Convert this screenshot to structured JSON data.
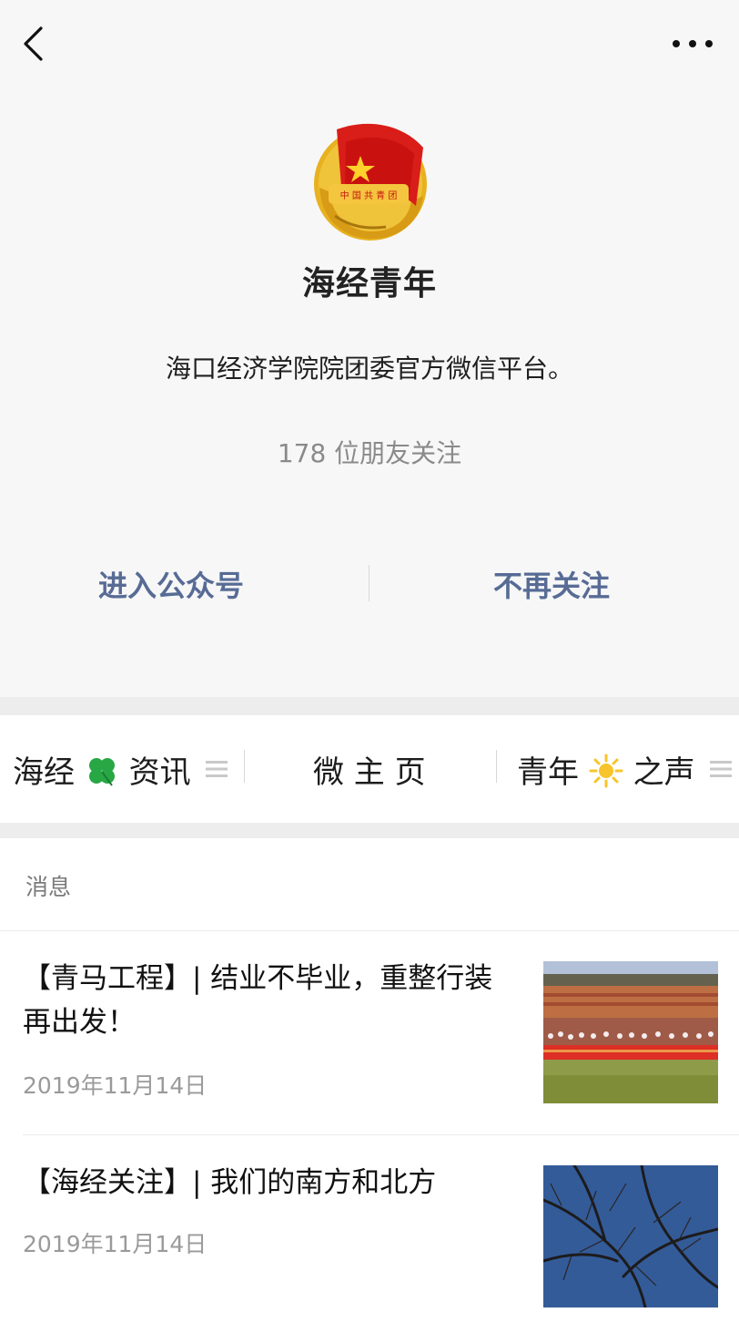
{
  "header": {
    "back_icon": "back-chevron-icon",
    "more_icon": "more-horizontal-icon"
  },
  "profile": {
    "avatar": "youth-league-emblem",
    "name": "海经青年",
    "description": "海口经济学院院团委官方微信平台。",
    "followers": "178 位朋友关注"
  },
  "actions": {
    "enter": "进入公众号",
    "unfollow": "不再关注"
  },
  "menu": {
    "item_1_prefix": "海经",
    "item_1_icon": "four-leaf-clover-icon",
    "item_1_suffix": "资讯",
    "item_2": "微 主 页",
    "item_3_prefix": "青年",
    "item_3_icon": "sun-icon",
    "item_3_suffix": "之声",
    "menu_icon": "hamburger-icon"
  },
  "messages": {
    "section_title": "消息",
    "articles": [
      {
        "title": "【青马工程】| 结业不毕业，重整行装再出发！",
        "date": "2019年11月14日",
        "thumbnail": "group-photo-stadium"
      },
      {
        "title": "【海经关注】| 我们的南方和北方",
        "date": "2019年11月14日",
        "thumbnail": "tree-branches-sky"
      }
    ]
  },
  "colors": {
    "link": "#576b95",
    "background": "#ededed",
    "secondary_text": "#8a8a8a"
  }
}
